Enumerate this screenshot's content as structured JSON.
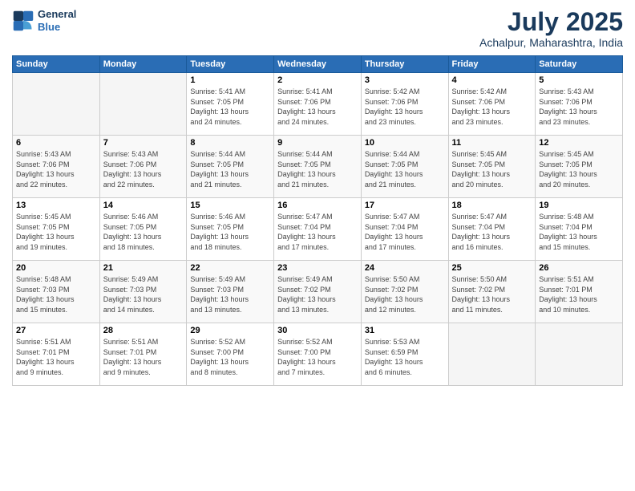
{
  "header": {
    "logo_line1": "General",
    "logo_line2": "Blue",
    "month": "July 2025",
    "location": "Achalpur, Maharashtra, India"
  },
  "days_of_week": [
    "Sunday",
    "Monday",
    "Tuesday",
    "Wednesday",
    "Thursday",
    "Friday",
    "Saturday"
  ],
  "weeks": [
    [
      {
        "day": "",
        "info": ""
      },
      {
        "day": "",
        "info": ""
      },
      {
        "day": "1",
        "info": "Sunrise: 5:41 AM\nSunset: 7:05 PM\nDaylight: 13 hours\nand 24 minutes."
      },
      {
        "day": "2",
        "info": "Sunrise: 5:41 AM\nSunset: 7:06 PM\nDaylight: 13 hours\nand 24 minutes."
      },
      {
        "day": "3",
        "info": "Sunrise: 5:42 AM\nSunset: 7:06 PM\nDaylight: 13 hours\nand 23 minutes."
      },
      {
        "day": "4",
        "info": "Sunrise: 5:42 AM\nSunset: 7:06 PM\nDaylight: 13 hours\nand 23 minutes."
      },
      {
        "day": "5",
        "info": "Sunrise: 5:43 AM\nSunset: 7:06 PM\nDaylight: 13 hours\nand 23 minutes."
      }
    ],
    [
      {
        "day": "6",
        "info": "Sunrise: 5:43 AM\nSunset: 7:06 PM\nDaylight: 13 hours\nand 22 minutes."
      },
      {
        "day": "7",
        "info": "Sunrise: 5:43 AM\nSunset: 7:06 PM\nDaylight: 13 hours\nand 22 minutes."
      },
      {
        "day": "8",
        "info": "Sunrise: 5:44 AM\nSunset: 7:05 PM\nDaylight: 13 hours\nand 21 minutes."
      },
      {
        "day": "9",
        "info": "Sunrise: 5:44 AM\nSunset: 7:05 PM\nDaylight: 13 hours\nand 21 minutes."
      },
      {
        "day": "10",
        "info": "Sunrise: 5:44 AM\nSunset: 7:05 PM\nDaylight: 13 hours\nand 21 minutes."
      },
      {
        "day": "11",
        "info": "Sunrise: 5:45 AM\nSunset: 7:05 PM\nDaylight: 13 hours\nand 20 minutes."
      },
      {
        "day": "12",
        "info": "Sunrise: 5:45 AM\nSunset: 7:05 PM\nDaylight: 13 hours\nand 20 minutes."
      }
    ],
    [
      {
        "day": "13",
        "info": "Sunrise: 5:45 AM\nSunset: 7:05 PM\nDaylight: 13 hours\nand 19 minutes."
      },
      {
        "day": "14",
        "info": "Sunrise: 5:46 AM\nSunset: 7:05 PM\nDaylight: 13 hours\nand 18 minutes."
      },
      {
        "day": "15",
        "info": "Sunrise: 5:46 AM\nSunset: 7:05 PM\nDaylight: 13 hours\nand 18 minutes."
      },
      {
        "day": "16",
        "info": "Sunrise: 5:47 AM\nSunset: 7:04 PM\nDaylight: 13 hours\nand 17 minutes."
      },
      {
        "day": "17",
        "info": "Sunrise: 5:47 AM\nSunset: 7:04 PM\nDaylight: 13 hours\nand 17 minutes."
      },
      {
        "day": "18",
        "info": "Sunrise: 5:47 AM\nSunset: 7:04 PM\nDaylight: 13 hours\nand 16 minutes."
      },
      {
        "day": "19",
        "info": "Sunrise: 5:48 AM\nSunset: 7:04 PM\nDaylight: 13 hours\nand 15 minutes."
      }
    ],
    [
      {
        "day": "20",
        "info": "Sunrise: 5:48 AM\nSunset: 7:03 PM\nDaylight: 13 hours\nand 15 minutes."
      },
      {
        "day": "21",
        "info": "Sunrise: 5:49 AM\nSunset: 7:03 PM\nDaylight: 13 hours\nand 14 minutes."
      },
      {
        "day": "22",
        "info": "Sunrise: 5:49 AM\nSunset: 7:03 PM\nDaylight: 13 hours\nand 13 minutes."
      },
      {
        "day": "23",
        "info": "Sunrise: 5:49 AM\nSunset: 7:02 PM\nDaylight: 13 hours\nand 13 minutes."
      },
      {
        "day": "24",
        "info": "Sunrise: 5:50 AM\nSunset: 7:02 PM\nDaylight: 13 hours\nand 12 minutes."
      },
      {
        "day": "25",
        "info": "Sunrise: 5:50 AM\nSunset: 7:02 PM\nDaylight: 13 hours\nand 11 minutes."
      },
      {
        "day": "26",
        "info": "Sunrise: 5:51 AM\nSunset: 7:01 PM\nDaylight: 13 hours\nand 10 minutes."
      }
    ],
    [
      {
        "day": "27",
        "info": "Sunrise: 5:51 AM\nSunset: 7:01 PM\nDaylight: 13 hours\nand 9 minutes."
      },
      {
        "day": "28",
        "info": "Sunrise: 5:51 AM\nSunset: 7:01 PM\nDaylight: 13 hours\nand 9 minutes."
      },
      {
        "day": "29",
        "info": "Sunrise: 5:52 AM\nSunset: 7:00 PM\nDaylight: 13 hours\nand 8 minutes."
      },
      {
        "day": "30",
        "info": "Sunrise: 5:52 AM\nSunset: 7:00 PM\nDaylight: 13 hours\nand 7 minutes."
      },
      {
        "day": "31",
        "info": "Sunrise: 5:53 AM\nSunset: 6:59 PM\nDaylight: 13 hours\nand 6 minutes."
      },
      {
        "day": "",
        "info": ""
      },
      {
        "day": "",
        "info": ""
      }
    ]
  ]
}
